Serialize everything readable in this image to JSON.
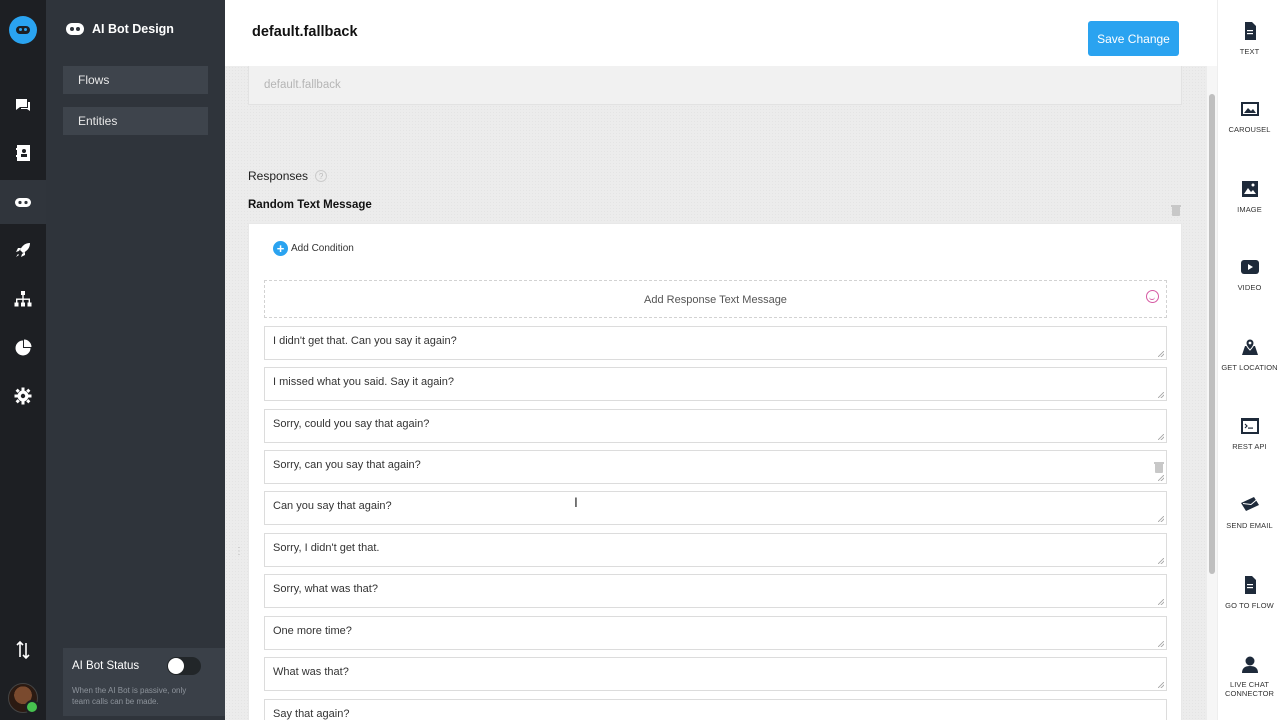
{
  "app": {
    "section_title": "AI Bot Design",
    "nav": [
      "Flows",
      "Entities"
    ]
  },
  "rail": {
    "icons": [
      "logo-icon",
      "chat-icon",
      "contacts-icon",
      "bot-icon",
      "rocket-icon",
      "hierarchy-icon",
      "pie-chart-icon",
      "gear-icon",
      "transfer-icon"
    ]
  },
  "status": {
    "label": "AI Bot Status",
    "help": "When the AI Bot is passive, only team calls can be made.",
    "enabled": false
  },
  "header": {
    "title": "default.fallback",
    "save_label": "Save Change"
  },
  "editor": {
    "name_value": "default.fallback",
    "responses_label": "Responses",
    "responses_help": "?",
    "block_title": "Random Text Message",
    "add_condition": "Add Condition",
    "add_response": "Add Response Text Message",
    "responses": [
      "I didn't get that. Can you say it again?",
      "I missed what you said. Say it again?",
      "Sorry, could you say that again?",
      "Sorry, can you say that again?",
      "Can you say that again?",
      "Sorry, I didn't get that.",
      "Sorry, what was that?",
      "One more time?",
      "What was that?",
      "Say that again?"
    ]
  },
  "components": [
    {
      "label": "TEXT",
      "icon": "text-document-icon"
    },
    {
      "label": "CAROUSEL",
      "icon": "carousel-icon"
    },
    {
      "label": "IMAGE",
      "icon": "image-icon"
    },
    {
      "label": "VIDEO",
      "icon": "video-icon"
    },
    {
      "label": "GET LOCATION",
      "icon": "location-icon"
    },
    {
      "label": "REST API",
      "icon": "terminal-icon"
    },
    {
      "label": "SEND EMAIL",
      "icon": "email-icon"
    },
    {
      "label": "GO TO FLOW",
      "icon": "flow-document-icon"
    },
    {
      "label": "LIVE CHAT CONNECTOR",
      "icon": "agent-icon"
    }
  ],
  "colors": {
    "accent": "#2aa3f0",
    "rail_bg": "#1d1f23",
    "sidebar_bg": "#2f343b",
    "emoji": "#d65aa3"
  }
}
